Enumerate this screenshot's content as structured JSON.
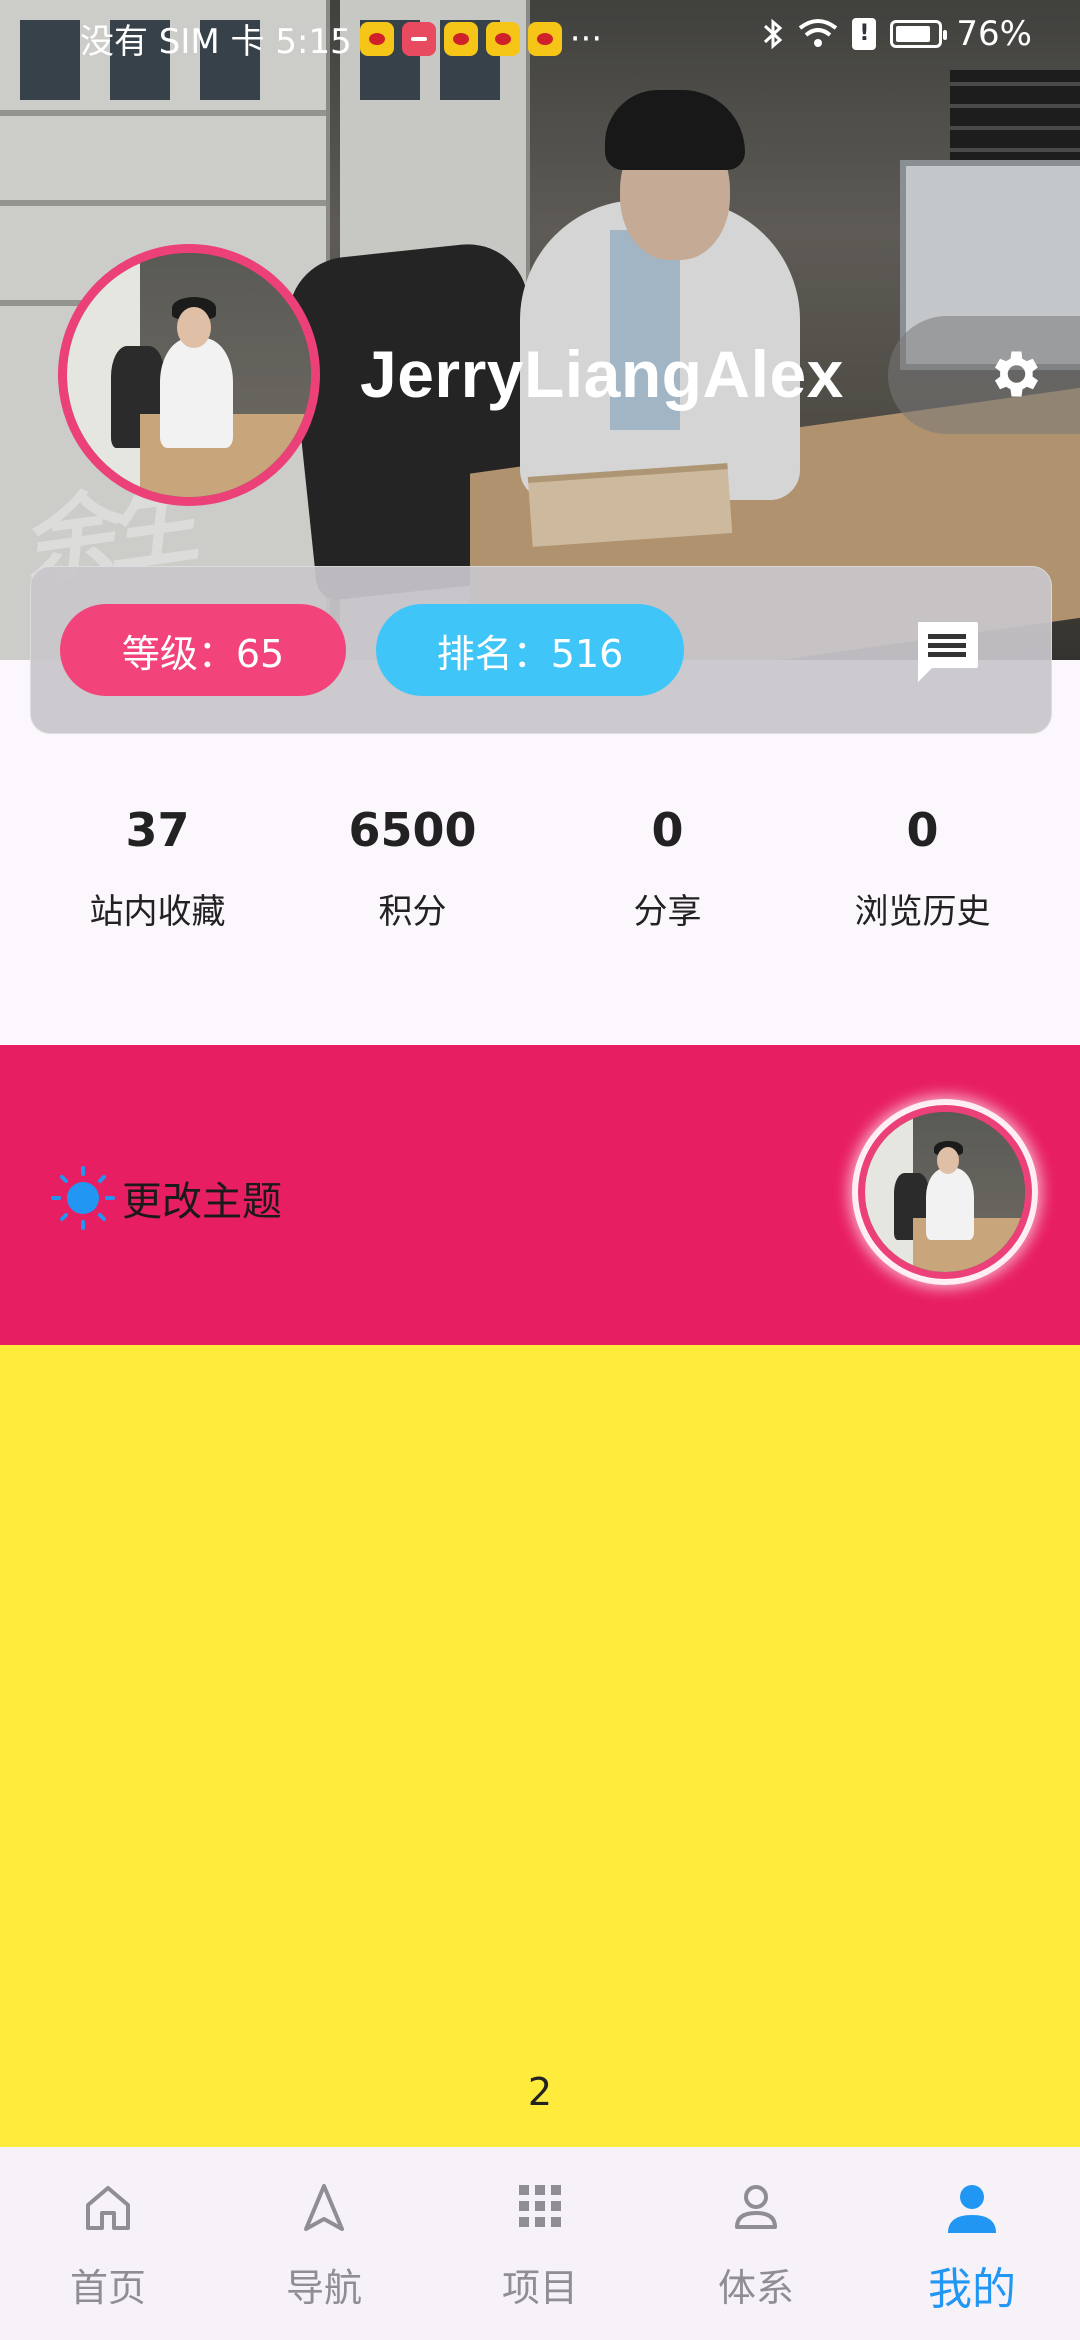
{
  "status_bar": {
    "carrier_time": "没有 SIM 卡 5:15",
    "more": "···",
    "battery": "76%",
    "sim_badge": "!"
  },
  "profile": {
    "username": "JerryLiangAlex",
    "level": "等级：65",
    "rank": "排名：516"
  },
  "stats": [
    {
      "value": "37",
      "label": "站内收藏"
    },
    {
      "value": "6500",
      "label": "积分"
    },
    {
      "value": "0",
      "label": "分享"
    },
    {
      "value": "0",
      "label": "浏览历史"
    }
  ],
  "theme": {
    "label": "更改主题"
  },
  "page_indicator": "2",
  "bottom_nav": [
    {
      "label": "首页",
      "icon": "home-icon"
    },
    {
      "label": "导航",
      "icon": "navigation-icon"
    },
    {
      "label": "项目",
      "icon": "grid-icon"
    },
    {
      "label": "体系",
      "icon": "person-outline-icon"
    },
    {
      "label": "我的",
      "icon": "person-filled-icon",
      "active": true
    }
  ],
  "colors": {
    "accent_pink": "#e81e63",
    "level_pill": "#f2447a",
    "rank_pill": "#3fc5f7",
    "content_yellow": "#ffeb3b",
    "nav_active": "#2196f3"
  }
}
